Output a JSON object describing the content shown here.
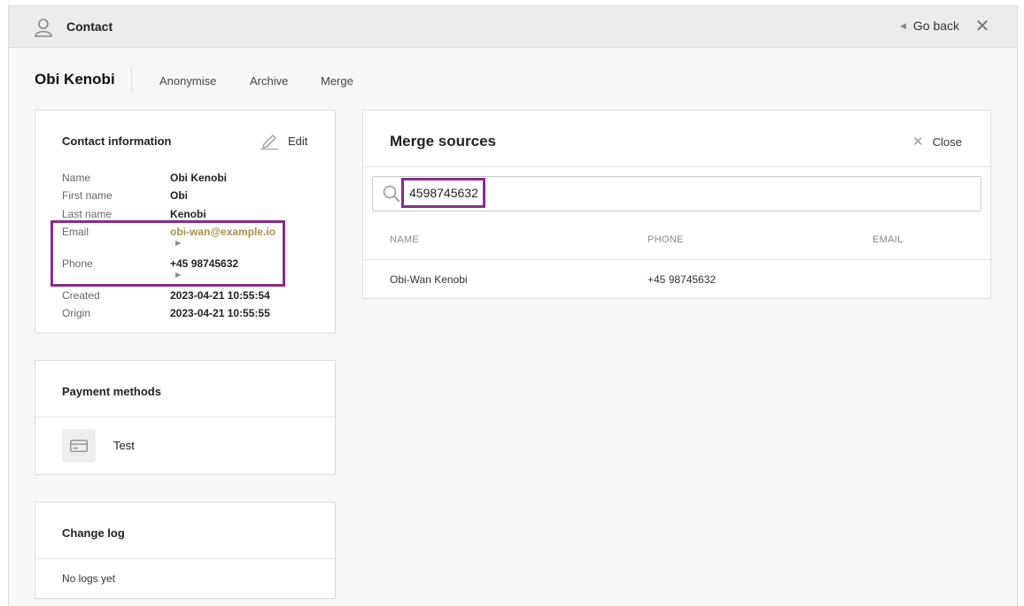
{
  "header": {
    "title": "Contact",
    "go_back_label": "Go back"
  },
  "contact": {
    "name": "Obi Kenobi",
    "actions": [
      "Anonymise",
      "Archive",
      "Merge"
    ]
  },
  "contact_info": {
    "title": "Contact information",
    "edit_label": "Edit",
    "fields": [
      {
        "label": "Name",
        "value": "Obi Kenobi"
      },
      {
        "label": "First name",
        "value": "Obi"
      },
      {
        "label": "Last name",
        "value": "Kenobi"
      },
      {
        "label": "Email",
        "value": "obi-wan@example.io"
      },
      {
        "label": "Phone",
        "value": "+45 98745632"
      },
      {
        "label": "Created",
        "value": "2023-04-21 10:55:54"
      },
      {
        "label": "Origin",
        "value": "2023-04-21 10:55:55"
      }
    ]
  },
  "payment_methods": {
    "title": "Payment methods",
    "items": [
      {
        "label": "Test",
        "icon": "credit-card-icon"
      }
    ]
  },
  "change_log": {
    "title": "Change log",
    "empty_text": "No logs yet"
  },
  "merge_sources": {
    "title": "Merge sources",
    "close_label": "Close",
    "search_value": "4598745632",
    "columns": [
      "NAME",
      "PHONE",
      "EMAIL"
    ],
    "rows": [
      {
        "name": "Obi-Wan Kenobi",
        "phone": "+45 98745632",
        "email": ""
      }
    ]
  },
  "colors": {
    "highlight": "#8b2a8b",
    "link": "#a8914a"
  }
}
